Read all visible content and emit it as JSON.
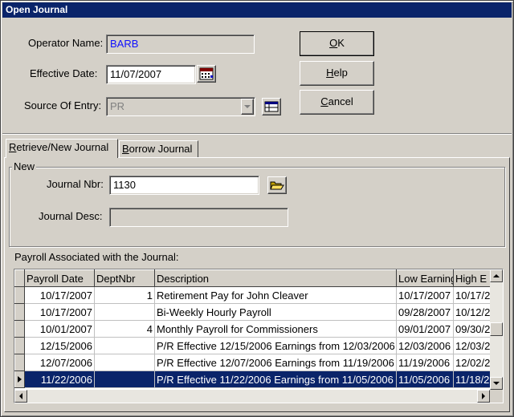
{
  "window": {
    "title": "Open Journal"
  },
  "form": {
    "operator_label": "Operator Name:",
    "operator_value": "BARB",
    "effective_date_label": "Effective Date:",
    "effective_date_value": "11/07/2007",
    "source_label": "Source Of Entry:",
    "source_value": "PR"
  },
  "buttons": {
    "ok": {
      "mnemonic": "O",
      "rest": "K"
    },
    "help": {
      "mnemonic": "H",
      "rest": "elp"
    },
    "cancel": {
      "mnemonic": "C",
      "rest": "ancel"
    }
  },
  "tabs": [
    {
      "mnemonic": "R",
      "rest": "etrieve/New Journal",
      "active": true
    },
    {
      "mnemonic": "B",
      "rest": "orrow Journal",
      "active": false
    }
  ],
  "new_group": {
    "legend": "New",
    "journal_nbr_label": "Journal Nbr:",
    "journal_nbr_value": "1130",
    "journal_desc_label": "Journal Desc:",
    "journal_desc_value": ""
  },
  "payroll": {
    "label": "Payroll Associated with the Journal:",
    "columns": [
      "Payroll Date",
      "DeptNbr",
      "Description",
      "Low Earnings",
      "High E"
    ],
    "rows": [
      {
        "date": "10/17/2007",
        "dept": "1",
        "desc": "Retirement Pay for John Cleaver",
        "low": "10/17/2007",
        "high": "10/17/2",
        "selected": false,
        "current": false
      },
      {
        "date": "10/17/2007",
        "dept": "",
        "desc": "Bi-Weekly Hourly Payroll",
        "low": "09/28/2007",
        "high": "10/12/2",
        "selected": false,
        "current": false
      },
      {
        "date": "10/01/2007",
        "dept": "4",
        "desc": "Monthly Payroll for Commissioners",
        "low": "09/01/2007",
        "high": "09/30/2",
        "selected": false,
        "current": false
      },
      {
        "date": "12/15/2006",
        "dept": "",
        "desc": "P/R Effective 12/15/2006 Earnings from 12/03/2006",
        "low": "12/03/2006",
        "high": "12/03/2",
        "selected": false,
        "current": false
      },
      {
        "date": "12/07/2006",
        "dept": "",
        "desc": "P/R Effective 12/07/2006 Earnings from 11/19/2006",
        "low": "11/19/2006",
        "high": "12/02/2",
        "selected": false,
        "current": false
      },
      {
        "date": "11/22/2006",
        "dept": "",
        "desc": "P/R Effective 11/22/2006 Earnings from 11/05/2006",
        "low": "11/05/2006",
        "high": "11/18/2",
        "selected": true,
        "current": true
      }
    ]
  },
  "colors": {
    "title_bar": "#0a246a",
    "selection": "#0a246a",
    "face": "#d4d0c8",
    "operator_text": "#1010ff"
  },
  "icons": {
    "calendar": "calendar-icon",
    "lookup": "lookup-table-icon",
    "folder": "folder-open-icon"
  }
}
